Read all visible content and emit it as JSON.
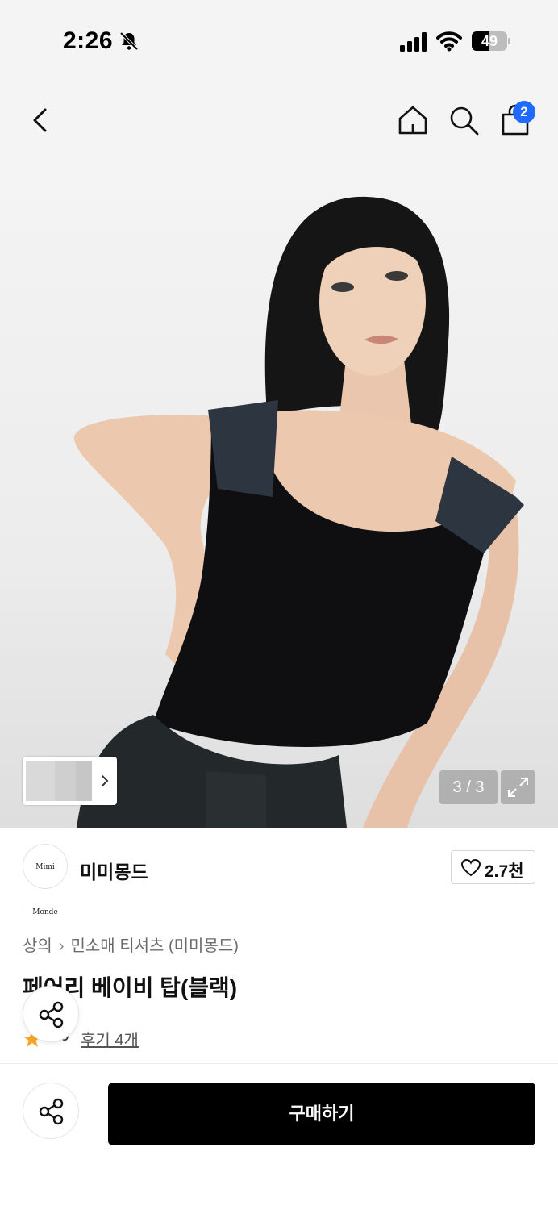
{
  "status_bar": {
    "time": "2:26",
    "battery": "49"
  },
  "header": {
    "cart_count": "2"
  },
  "gallery": {
    "counter": "3 / 3"
  },
  "brand": {
    "logo_text": "Mimi Monde",
    "name": "미미몽드",
    "likes": "2.7천"
  },
  "product": {
    "breadcrumb": [
      "상의",
      "민소매 티셔츠 (미미몽드)"
    ],
    "title": "페어리 베이비 탑(블랙)",
    "rating": "5.0",
    "reviews": "후기 4개"
  },
  "actions": {
    "buy_label": "구매하기"
  },
  "colors": {
    "badge": "#1f6bff",
    "buy_button": "#000000",
    "star": "#f5a623"
  }
}
